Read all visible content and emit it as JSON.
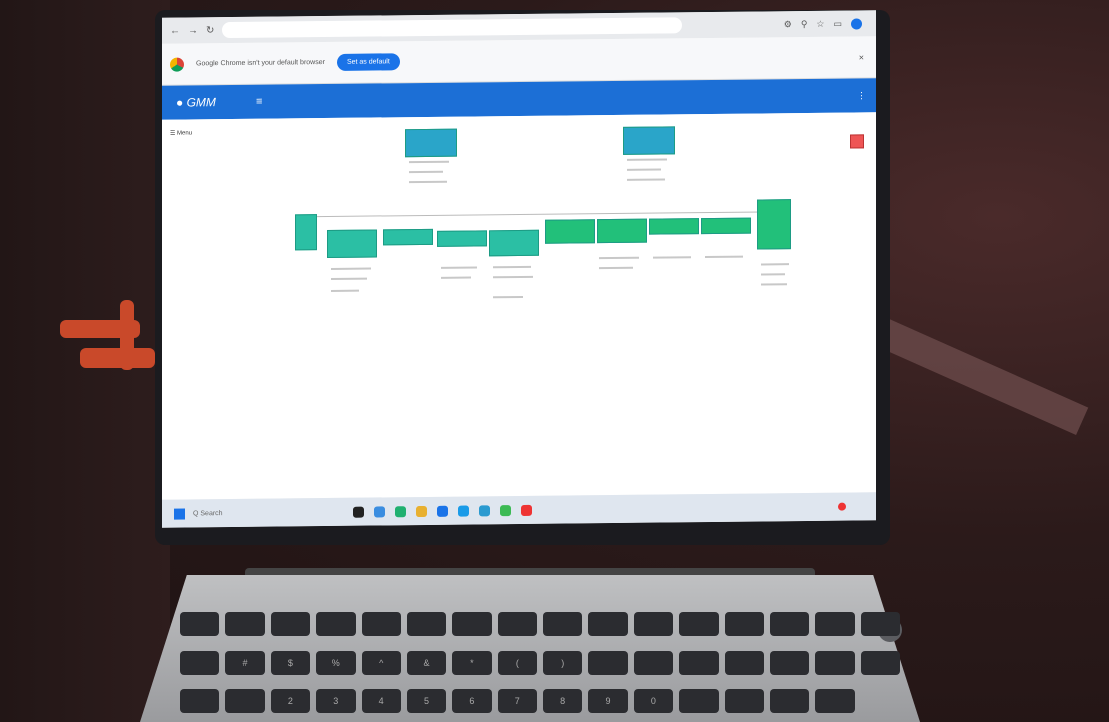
{
  "browser": {
    "url": "",
    "info_text": "Google Chrome isn't your default browser",
    "set_default_label": "Set as default",
    "close_label": "×"
  },
  "app": {
    "logo": "● GMM",
    "menu_icon": "≡",
    "more": "⋮",
    "breadcrumbs": [
      "",
      "",
      "",
      ""
    ]
  },
  "sidebar": {
    "header": "☰ Menu",
    "subheader": "",
    "items": [
      "",
      "",
      "",
      "",
      "",
      "",
      "",
      "",
      "",
      ""
    ]
  },
  "taskbar": {
    "search": "Q  Search",
    "tray_time": "",
    "tray_date": ""
  },
  "keyboard": {
    "keys_row3": [
      "",
      "#",
      "$",
      "%",
      "^",
      "&",
      "*",
      "(",
      ")",
      "",
      "",
      "",
      "",
      "",
      ""
    ],
    "keys_row4": [
      "",
      "",
      "2",
      "3",
      "4",
      "5",
      "6",
      "7",
      "8",
      "9",
      "0",
      "",
      "",
      "",
      ""
    ]
  }
}
